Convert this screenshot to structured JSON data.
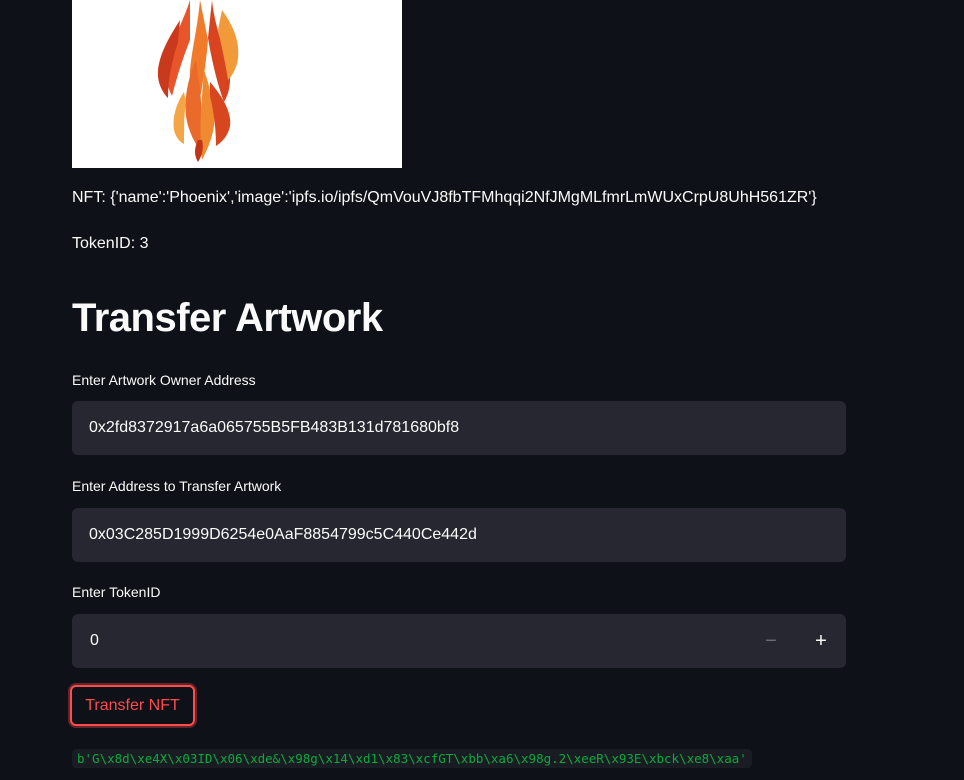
{
  "nft": {
    "image_icon": "phoenix-artwork",
    "info_text": "NFT: {'name':'Phoenix','image':'ipfs.io/ipfs/QmVouVJ8fbTFMhqqi2NfJMgMLfmrLmWUxCrpU8UhH561ZR'}",
    "token_text": "TokenID: 3"
  },
  "transfer": {
    "title": "Transfer Artwork",
    "owner_label": "Enter Artwork Owner Address",
    "owner_value": "0x2fd8372917a6a065755B5FB483B131d781680bf8",
    "to_label": "Enter Address to Transfer Artwork",
    "to_value": "0x03C285D1999D6254e0AaF8854799c5C440Ce442d",
    "token_label": "Enter TokenID",
    "token_value": "0",
    "minus": "−",
    "plus": "+",
    "button_label": "Transfer NFT"
  },
  "result": {
    "code": "b'G\\x8d\\xe4X\\x03ID\\x06\\xde&\\x98g\\x14\\xd1\\x83\\xcfGT\\xbb\\xa6\\x98g.2\\xeeR\\x93E\\xbck\\xe8\\xaa'"
  },
  "colors": {
    "background": "#0e1117",
    "input": "#262730",
    "accent": "#ff4b4b",
    "code_text": "#09ab3b"
  }
}
